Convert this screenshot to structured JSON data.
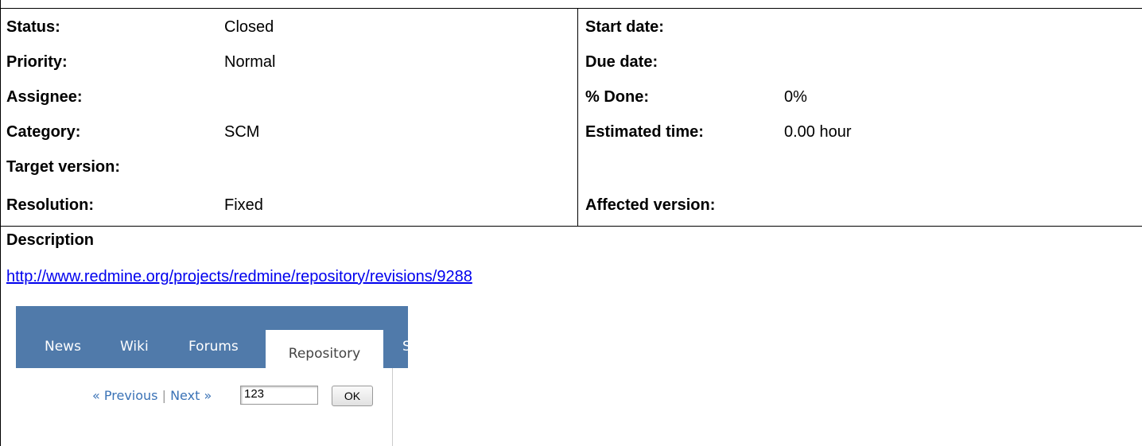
{
  "attributes": {
    "left": [
      {
        "label": "Status:",
        "value": "Closed"
      },
      {
        "label": "Priority:",
        "value": "Normal"
      },
      {
        "label": "Assignee:",
        "value": ""
      },
      {
        "label": "Category:",
        "value": "SCM"
      },
      {
        "label": "Target version:",
        "value": ""
      },
      {
        "label": "Resolution:",
        "value": "Fixed"
      }
    ],
    "right": [
      {
        "label": "Start date:",
        "value": ""
      },
      {
        "label": "Due date:",
        "value": ""
      },
      {
        "label": "% Done:",
        "value": "0%"
      },
      {
        "label": "Estimated time:",
        "value": "0.00 hour"
      },
      {
        "label": "",
        "value": ""
      },
      {
        "label": "Affected version:",
        "value": ""
      }
    ]
  },
  "description": {
    "title": "Description",
    "link": "http://www.redmine.org/projects/redmine/repository/revisions/9288"
  },
  "screenshot": {
    "tabs": [
      "News",
      "Wiki",
      "Forums"
    ],
    "active_tab": "Repository",
    "cut_tab": "S",
    "nav_prev": "« Previous",
    "nav_sep": "|",
    "nav_next": "Next »",
    "revision_value": "123",
    "ok_label": "OK",
    "colors": {
      "menu_bar": "#507aaa",
      "link": "#3a72b6"
    }
  }
}
